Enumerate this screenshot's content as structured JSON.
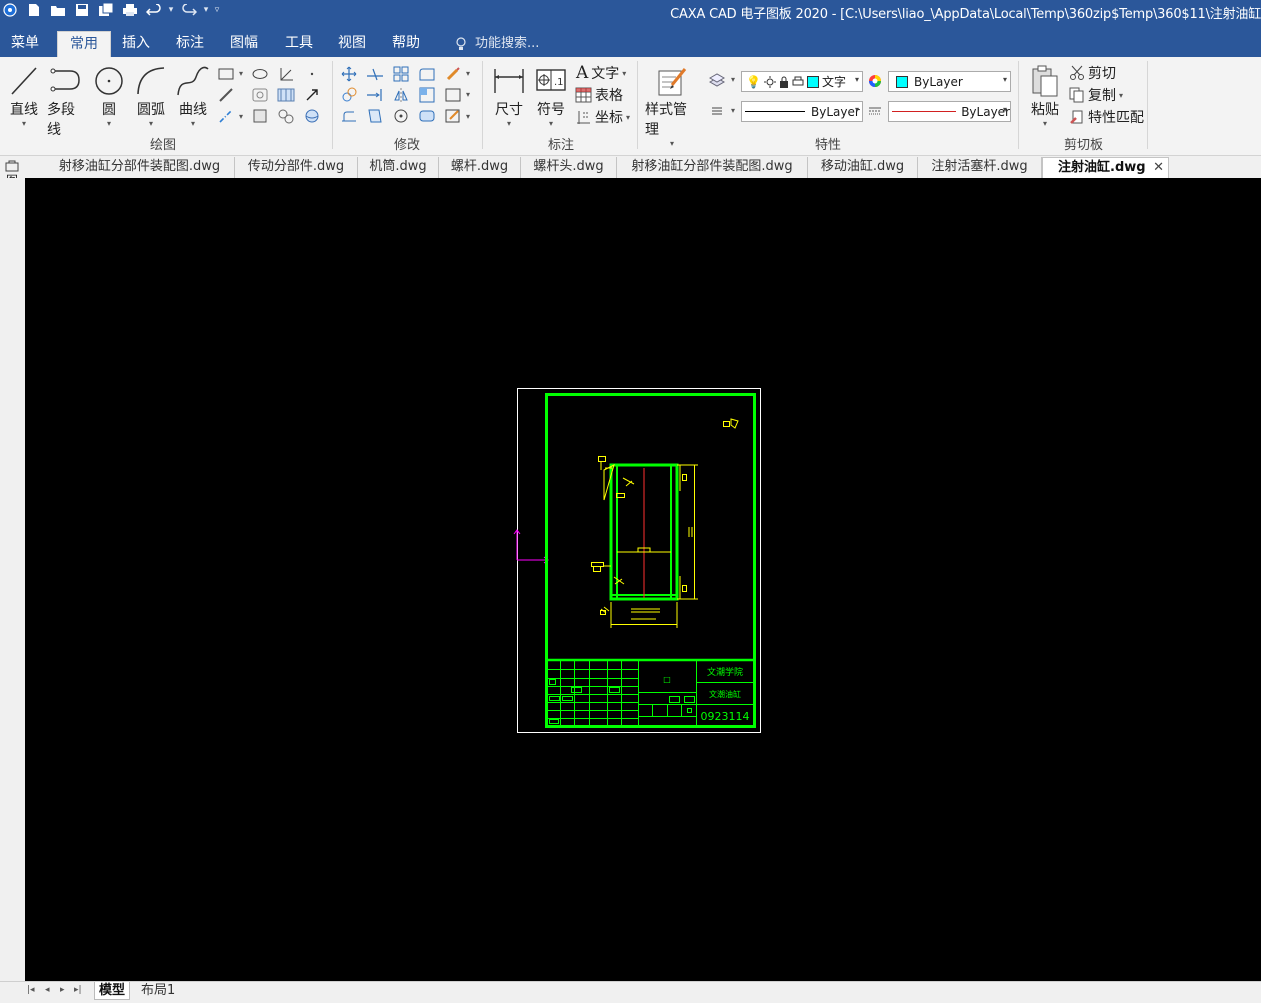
{
  "title_bar": {
    "title": "CAXA CAD 电子图板 2020 - [C:\\Users\\liao_\\AppData\\Local\\Temp\\360zip$Temp\\360$11\\注射油缸"
  },
  "ribbon_tabs": [
    {
      "label": "菜单",
      "active": false
    },
    {
      "label": "常用",
      "active": true
    },
    {
      "label": "插入",
      "active": false
    },
    {
      "label": "标注",
      "active": false
    },
    {
      "label": "图幅",
      "active": false
    },
    {
      "label": "工具",
      "active": false
    },
    {
      "label": "视图",
      "active": false
    },
    {
      "label": "帮助",
      "active": false
    }
  ],
  "search": {
    "placeholder": "功能搜索..."
  },
  "ribbon": {
    "draw": {
      "group_label": "绘图",
      "line": "直线",
      "polyline": "多段线",
      "circle": "圆",
      "arc": "圆弧",
      "curve": "曲线"
    },
    "modify": {
      "group_label": "修改"
    },
    "annotate": {
      "group_label": "标注",
      "dimension": "尺寸",
      "symbol": "符号",
      "text": "文字",
      "table": "表格",
      "coordinate": "坐标"
    },
    "properties": {
      "group_label": "特性",
      "style_manager": "样式管理",
      "layer_name": "文字",
      "color": "ByLayer",
      "linetype": "ByLayer",
      "lineweight": "ByLayer",
      "layer_swatch_color": "#00ffff",
      "color_swatch": "#00ffff",
      "lineweight_line_color": "#d22020"
    },
    "clipboard": {
      "group_label": "剪切板",
      "paste": "粘贴",
      "cut": "剪切",
      "copy": "复制",
      "match": "特性匹配"
    }
  },
  "sidebar": {
    "label": "图库"
  },
  "doc_tabs": [
    {
      "label": "射移油缸分部件装配图.dwg",
      "active": false
    },
    {
      "label": "传动分部件.dwg",
      "active": false
    },
    {
      "label": "机筒.dwg",
      "active": false
    },
    {
      "label": "螺杆.dwg",
      "active": false
    },
    {
      "label": "螺杆头.dwg",
      "active": false
    },
    {
      "label": "射移油缸分部件装配图.dwg",
      "active": false
    },
    {
      "label": "移动油缸.dwg",
      "active": false
    },
    {
      "label": "注射活塞杆.dwg",
      "active": false
    },
    {
      "label": "注射油缸.dwg",
      "active": true
    }
  ],
  "drawing": {
    "frame_color": "#00ff00",
    "geometry_color": "#ffff00",
    "axis_color": "#ff3030",
    "ucs_color": "#ff00ff",
    "institution": "文潮学院",
    "drawing_title": "文潮油缸",
    "drawing_number": "0923114",
    "title_block_note": "□"
  },
  "bottom_tabs": [
    {
      "label": "模型",
      "active": true
    },
    {
      "label": "布局1",
      "active": false
    }
  ]
}
